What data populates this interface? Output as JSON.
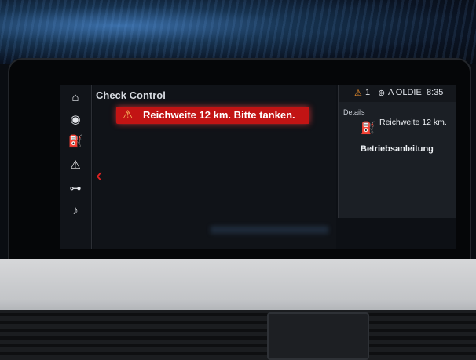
{
  "screen": {
    "title": "Check Control",
    "warning_message": "Reichweite 12 km. Bitte tanken.",
    "status_bar": {
      "warning_count": "1",
      "radio_station": "A OLDIE",
      "clock": "8:35"
    },
    "details_panel": {
      "heading": "Details",
      "fuel_range": "Reichweite 12 km.",
      "manual_link": "Betriebsanleitung"
    },
    "sidebar_icons": [
      "home-icon",
      "tire-pressure-icon",
      "oil-can-icon",
      "warning-triangle-icon",
      "car-lights-icon",
      "wiper-icon"
    ],
    "colors": {
      "warning_bar": "#c21414",
      "accent_orange": "#f29a1f",
      "back_chevron": "#dd2222"
    }
  }
}
